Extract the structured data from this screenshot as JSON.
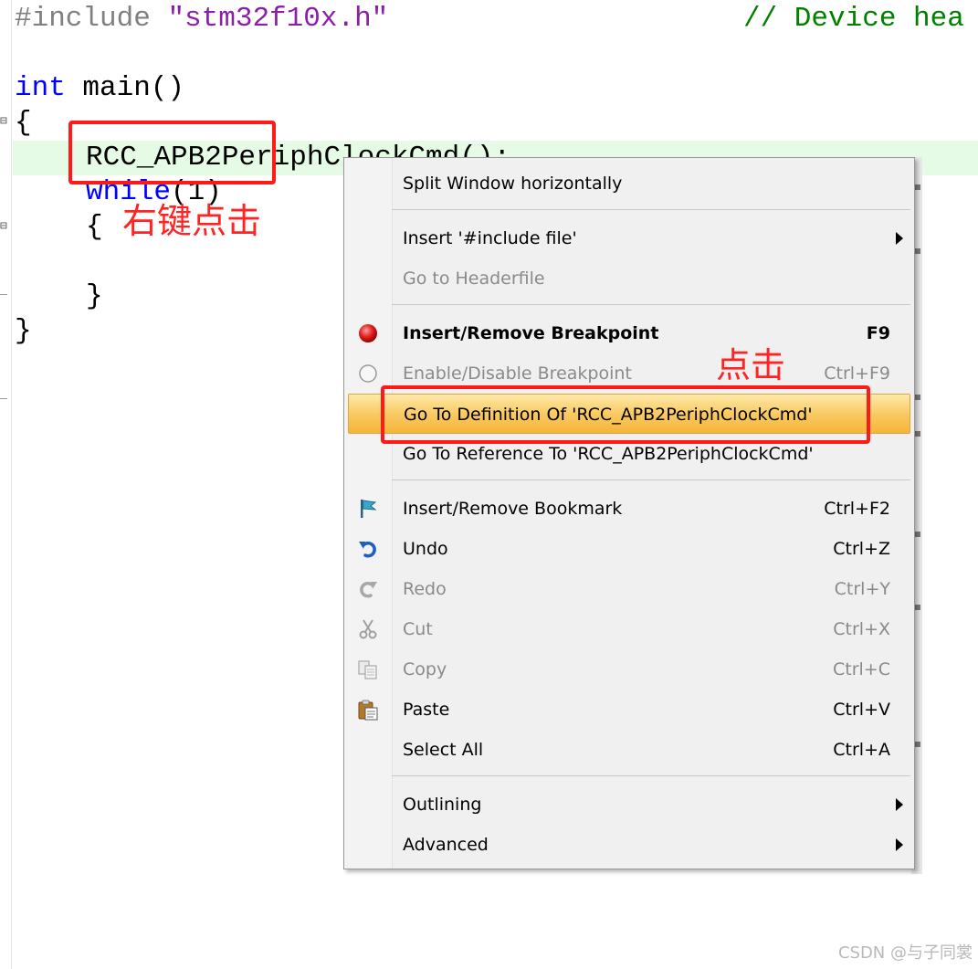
{
  "code": {
    "include_directive": "#include",
    "include_file": "\"stm32f10x.h\"",
    "include_comment": "// Device hea",
    "main_type": "int",
    "main_name": " main()",
    "open_brace_main": "{",
    "call_line": "RCC_APB2PeriphClockCmd();",
    "while_keyword": "while",
    "while_cond": "(1)",
    "open_brace_while": "{",
    "close_brace_while": "}",
    "close_brace_main": "}"
  },
  "annotations": {
    "right_click_note": "右键点击",
    "click_note": "点击"
  },
  "context_menu": {
    "split_window": "Split Window horizontally",
    "insert_include": "Insert '#include file'",
    "go_to_headerfile": "Go to Headerfile",
    "insert_remove_breakpoint": "Insert/Remove Breakpoint",
    "insert_remove_breakpoint_key": "F9",
    "enable_disable_breakpoint": "Enable/Disable Breakpoint",
    "enable_disable_breakpoint_key": "Ctrl+F9",
    "go_to_definition": "Go To Definition Of 'RCC_APB2PeriphClockCmd'",
    "go_to_reference": "Go To Reference To 'RCC_APB2PeriphClockCmd'",
    "insert_remove_bookmark": "Insert/Remove Bookmark",
    "insert_remove_bookmark_key": "Ctrl+F2",
    "undo": "Undo",
    "undo_key": "Ctrl+Z",
    "redo": "Redo",
    "redo_key": "Ctrl+Y",
    "cut": "Cut",
    "cut_key": "Ctrl+X",
    "copy": "Copy",
    "copy_key": "Ctrl+C",
    "paste": "Paste",
    "paste_key": "Ctrl+V",
    "select_all": "Select All",
    "select_all_key": "Ctrl+A",
    "outlining": "Outlining",
    "advanced": "Advanced"
  },
  "icons": {
    "breakpoint": "breakpoint-red-dot-icon",
    "breakpoint_disabled": "breakpoint-hollow-circle-icon",
    "bookmark": "bookmark-flag-icon",
    "undo": "undo-arrow-icon",
    "redo": "redo-arrow-icon",
    "cut": "scissors-icon",
    "copy": "copy-pages-icon",
    "paste": "clipboard-paste-icon",
    "submenu": "chevron-right-icon"
  },
  "colors": {
    "annotation_red": "#ff1a1a",
    "highlight_orange": "#f9c85e",
    "current_line_green": "#e6fbe6",
    "keyword_blue": "#0000ff"
  },
  "watermark": "CSDN @与子同裳"
}
